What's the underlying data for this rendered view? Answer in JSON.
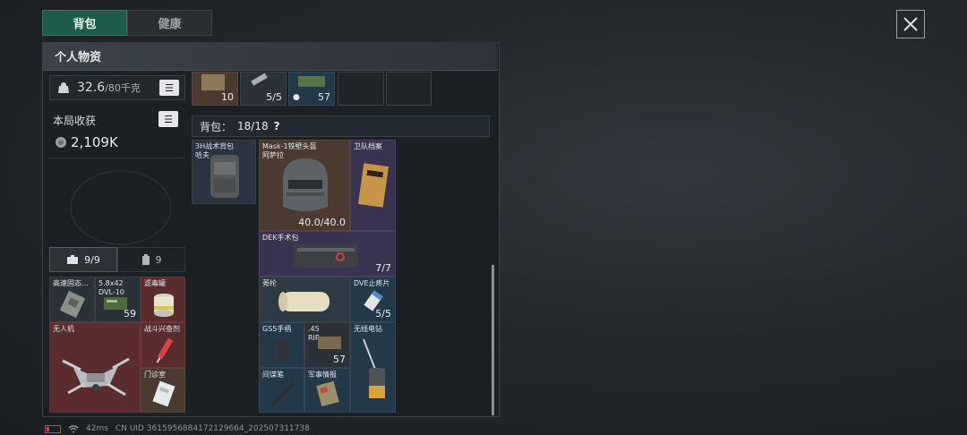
{
  "tabs": [
    {
      "label": "背包",
      "active": true
    },
    {
      "label": "健康",
      "active": false
    }
  ],
  "panel": {
    "title": "个人物资"
  },
  "weight": {
    "current": "32.6",
    "max": "/80千克"
  },
  "income": {
    "label": "本局收获",
    "value": "2,109K"
  },
  "sub_tabs": [
    {
      "icon": "toolbox-icon",
      "label": "9/9"
    },
    {
      "icon": "canister-icon",
      "label": "9"
    }
  ],
  "pouch_items": [
    {
      "name": "高速固态…",
      "count": ""
    },
    {
      "name": "5.8x42\nDVL-10",
      "count": "59"
    },
    {
      "name": "滤毒罐",
      "count": ""
    },
    {
      "name": "无人机",
      "count": ""
    },
    {
      "name": "战斗兴奋剂",
      "count": ""
    },
    {
      "name": "门诊室",
      "count": ""
    }
  ],
  "top_strip": [
    {
      "count": "10"
    },
    {
      "count": "5/5"
    },
    {
      "count": "57"
    },
    {
      "count": ""
    },
    {
      "count": ""
    }
  ],
  "backpack": {
    "label": "背包：",
    "capacity": "18/18",
    "help": "?"
  },
  "backpack_item": {
    "name": "3H战术背包\n哈夫"
  },
  "grid_items": [
    {
      "name": "Mask-1铁壁头盔\n阿萨拉",
      "count": "40.0/40.0"
    },
    {
      "name": "卫队档案",
      "count": ""
    },
    {
      "name": "DEK手术包",
      "count": "7/7"
    },
    {
      "name": "莠纶",
      "count": ""
    },
    {
      "name": "DVE止疼片",
      "count": "5/5"
    },
    {
      "name": "GS5手柄",
      "count": ""
    },
    {
      "name": ".45\nRIP",
      "count": "57"
    },
    {
      "name": "无线电钻",
      "count": ""
    },
    {
      "name": "间谍笔",
      "count": ""
    },
    {
      "name": "军事情报",
      "count": ""
    }
  ],
  "status": {
    "ping": "42ms",
    "uid": "CN UID 3615956884172129664_202507311738"
  }
}
